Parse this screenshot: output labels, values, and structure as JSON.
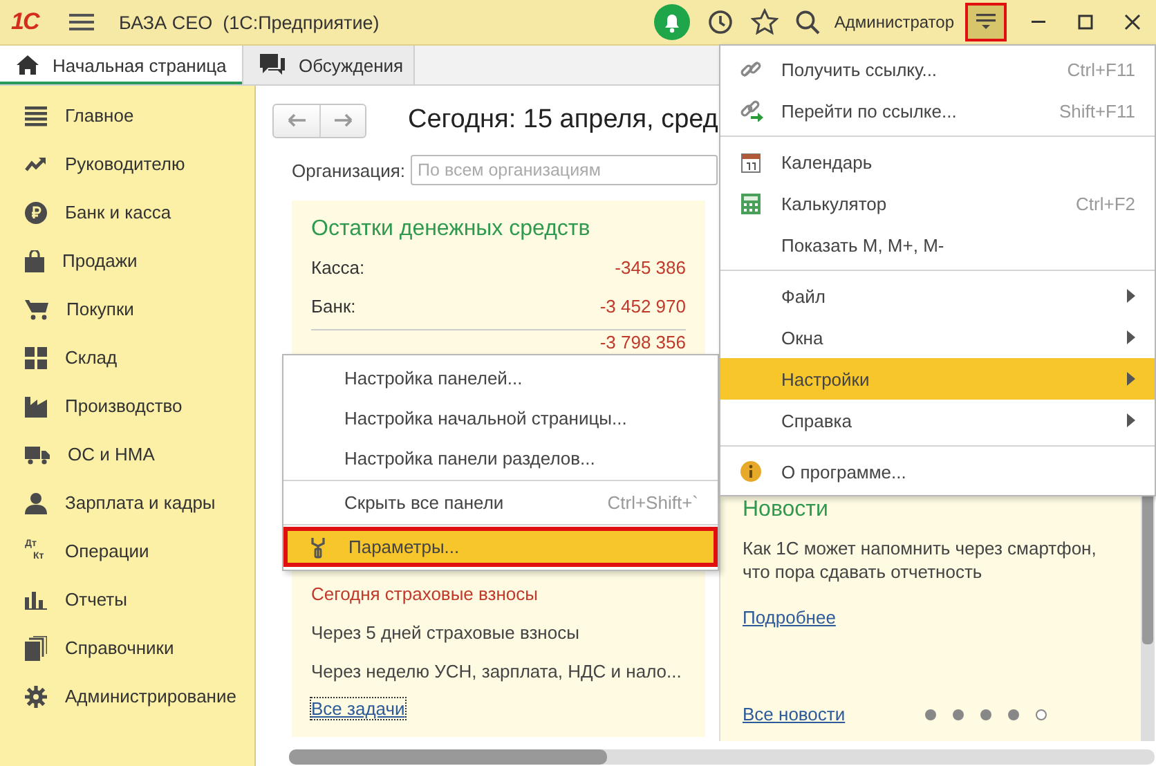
{
  "title_bar": {
    "logo": "1С",
    "title": "БАЗА CEO  (1С:Предприятие)",
    "user": "Администратор",
    "menu_button_active": true
  },
  "tabs": [
    {
      "label": "Начальная страница",
      "kind": "home",
      "selected": true
    },
    {
      "label": "Обсуждения",
      "kind": "chat",
      "selected": false
    }
  ],
  "sidebar": {
    "items": [
      {
        "label": "Главное",
        "kind": "list"
      },
      {
        "label": "Руководителю",
        "kind": "trend"
      },
      {
        "label": "Банк и касса",
        "kind": "ruble"
      },
      {
        "label": "Продажи",
        "kind": "bag"
      },
      {
        "label": "Покупки",
        "kind": "cart"
      },
      {
        "label": "Склад",
        "kind": "grid"
      },
      {
        "label": "Производство",
        "kind": "factory"
      },
      {
        "label": "ОС и НМА",
        "kind": "truck"
      },
      {
        "label": "Зарплата и кадры",
        "kind": "person"
      },
      {
        "label": "Операции",
        "kind": "dtkt",
        "icon_labels": [
          "Дт",
          "Кт"
        ]
      },
      {
        "label": "Отчеты",
        "kind": "bars"
      },
      {
        "label": "Справочники",
        "kind": "books"
      },
      {
        "label": "Администрирование",
        "kind": "gear"
      }
    ]
  },
  "home": {
    "heading": "Сегодня: 15 апреля, сред",
    "organization": {
      "label": "Организация:",
      "placeholder": "По всем организациям"
    },
    "cash": {
      "title": "Остатки денежных средств",
      "rows": [
        {
          "label": "Касса:",
          "value": "-345 386",
          "negative": true
        },
        {
          "label": "Банк:",
          "value": "-3 452 970",
          "negative": true
        }
      ],
      "total": {
        "value": "-3 798 356",
        "negative": true
      }
    },
    "tasks": [
      {
        "label": "Сегодня страховые взносы",
        "urgent": true
      },
      {
        "label": "Через 5 дней страховые взносы",
        "urgent": false
      },
      {
        "label": "Через неделю УСН, зарплата, НДС и нало...",
        "urgent": false
      }
    ],
    "all_tasks_link": {
      "label": "Все задачи",
      "focused": true
    }
  },
  "news": {
    "title": "Новости",
    "text": "Как 1С может напомнить через смартфон, что пора сдавать отчетность",
    "more_link": "Подробнее",
    "all_link": "Все новости",
    "pager": [
      {
        "selected": false
      },
      {
        "selected": false
      },
      {
        "selected": false
      },
      {
        "selected": false
      },
      {
        "selected": true
      }
    ]
  },
  "main_menu": {
    "groups": [
      [
        {
          "kind": "link",
          "label": "Получить ссылку...",
          "shortcut": "Ctrl+F11",
          "submenu": false,
          "selected": false
        },
        {
          "kind": "link-go",
          "label": "Перейти по ссылке...",
          "shortcut": "Shift+F11",
          "submenu": false,
          "selected": false
        }
      ],
      [
        {
          "kind": "calendar",
          "label": "Календарь",
          "submenu": false,
          "selected": false
        },
        {
          "kind": "calculator",
          "label": "Калькулятор",
          "shortcut": "Ctrl+F2",
          "submenu": false,
          "selected": false
        },
        {
          "kind": "plain",
          "label": "Показать M, M+, M-",
          "submenu": false,
          "selected": false
        }
      ],
      [
        {
          "kind": "plain",
          "label": "Файл",
          "submenu": true,
          "selected": false
        },
        {
          "kind": "plain",
          "label": "Окна",
          "submenu": true,
          "selected": false
        },
        {
          "kind": "plain",
          "label": "Настройки",
          "submenu": true,
          "selected": true
        },
        {
          "kind": "plain",
          "label": "Справка",
          "submenu": true,
          "selected": false
        }
      ],
      [
        {
          "kind": "info",
          "label": "О программе...",
          "submenu": false,
          "selected": false
        }
      ]
    ]
  },
  "settings_submenu": {
    "groups": [
      [
        {
          "kind": "plain",
          "label": "Настройка панелей...",
          "submenu": false,
          "selected": false
        },
        {
          "kind": "plain",
          "label": "Настройка начальной страницы...",
          "submenu": false,
          "selected": false
        },
        {
          "kind": "plain",
          "label": "Настройка панели разделов...",
          "submenu": false,
          "selected": false
        }
      ],
      [
        {
          "kind": "plain",
          "label": "Скрыть все панели",
          "shortcut": "Ctrl+Shift+`",
          "submenu": false,
          "selected": false
        }
      ],
      [
        {
          "kind": "wrench",
          "label": "Параметры...",
          "submenu": false,
          "selected": true
        }
      ]
    ]
  }
}
